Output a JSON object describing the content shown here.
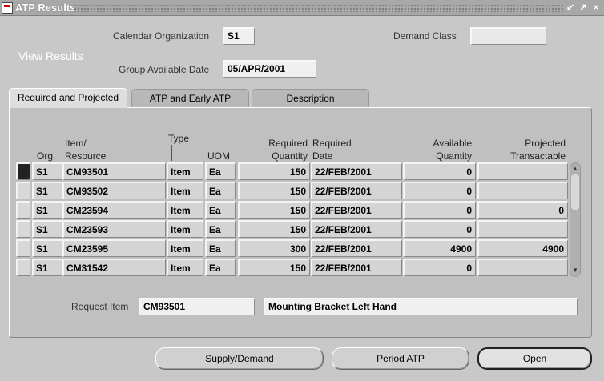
{
  "window": {
    "title": "ATP Results",
    "controls": [
      "↙",
      "↗",
      "×"
    ]
  },
  "header": {
    "calendar_org_label": "Calendar Organization",
    "calendar_org_value": "S1",
    "demand_class_label": "Demand Class",
    "demand_class_value": "",
    "view_results_label": "View Results",
    "group_date_label": "Group Available Date",
    "group_date_value": "05/APR/2001"
  },
  "tabs": [
    {
      "label": "Required and Projected",
      "active": true
    },
    {
      "label": "ATP and Early ATP",
      "active": false
    },
    {
      "label": "Description",
      "active": false
    }
  ],
  "table": {
    "headers": {
      "org": "Org",
      "item_1": "Item/",
      "item_2": "Resource",
      "type": "Type",
      "uom": "UOM",
      "req_qty_1": "Required",
      "req_qty_2": "Quantity",
      "req_date_1": "Required",
      "req_date_2": "Date",
      "avail_1": "Available",
      "avail_2": "Quantity",
      "proj_1": "Projected",
      "proj_2": "Transactable"
    },
    "rows": [
      {
        "org": "S1",
        "item": "CM93501",
        "type": "Item",
        "uom": "Ea",
        "req_qty": "150",
        "req_date": "22/FEB/2001",
        "avail_qty": "0",
        "projected": ""
      },
      {
        "org": "S1",
        "item": "CM93502",
        "type": "Item",
        "uom": "Ea",
        "req_qty": "150",
        "req_date": "22/FEB/2001",
        "avail_qty": "0",
        "projected": ""
      },
      {
        "org": "S1",
        "item": "CM23594",
        "type": "Item",
        "uom": "Ea",
        "req_qty": "150",
        "req_date": "22/FEB/2001",
        "avail_qty": "0",
        "projected": "0"
      },
      {
        "org": "S1",
        "item": "CM23593",
        "type": "Item",
        "uom": "Ea",
        "req_qty": "150",
        "req_date": "22/FEB/2001",
        "avail_qty": "0",
        "projected": ""
      },
      {
        "org": "S1",
        "item": "CM23595",
        "type": "Item",
        "uom": "Ea",
        "req_qty": "300",
        "req_date": "22/FEB/2001",
        "avail_qty": "4900",
        "projected": "4900"
      },
      {
        "org": "S1",
        "item": "CM31542",
        "type": "Item",
        "uom": "Ea",
        "req_qty": "150",
        "req_date": "22/FEB/2001",
        "avail_qty": "0",
        "projected": ""
      }
    ]
  },
  "footer": {
    "request_item_label": "Request Item",
    "request_item_value": "CM93501",
    "request_item_desc": "Mounting Bracket Left Hand"
  },
  "buttons": {
    "supply_demand": "Supply/Demand",
    "period_atp": "Period ATP",
    "open": "Open"
  }
}
